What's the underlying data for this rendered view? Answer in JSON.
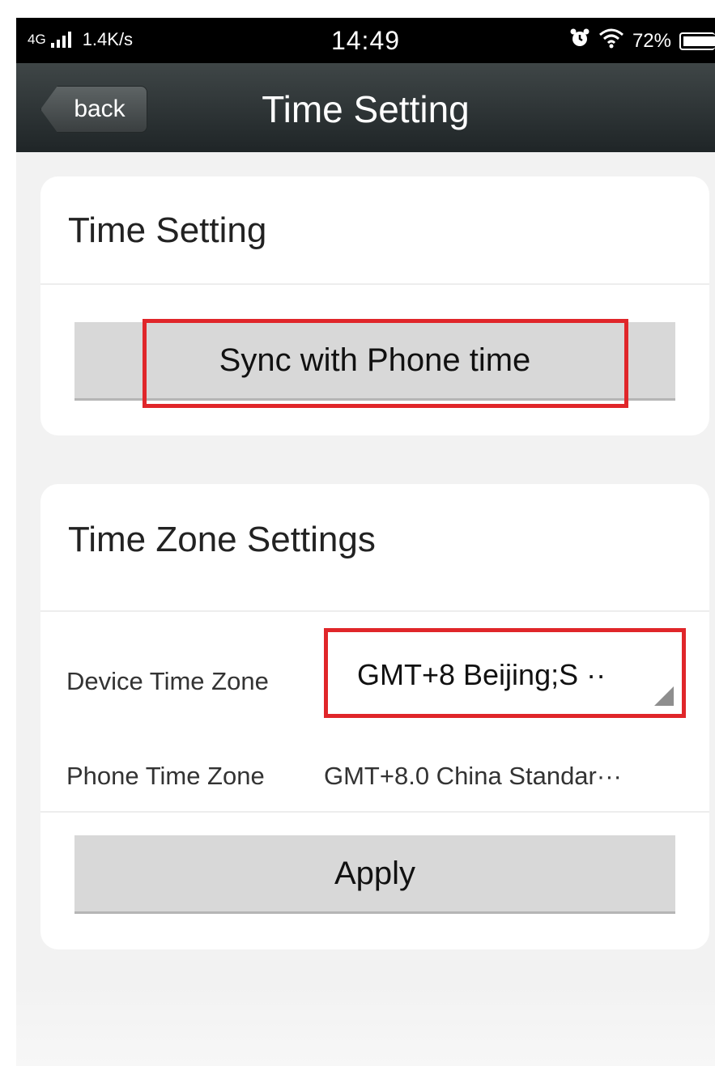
{
  "status_bar": {
    "network": "4G",
    "speed": "1.4K/s",
    "time": "14:49",
    "battery": "72%",
    "icons": [
      "signal-icon",
      "alarm-icon",
      "wifi-icon",
      "battery-icon"
    ]
  },
  "nav": {
    "back_label": "back",
    "title": "Time Setting"
  },
  "time_card": {
    "title": "Time Setting",
    "sync_label": "Sync with Phone time"
  },
  "zone_card": {
    "title": "Time Zone Settings",
    "device_label": "Device Time Zone",
    "device_value": "GMT+8 Beijing;S ··",
    "phone_label": "Phone Time Zone",
    "phone_value": "GMT+8.0  China Standar···",
    "apply_label": "Apply"
  },
  "colors": {
    "highlight": "#e0262a",
    "nav_bar": "#2c3334",
    "button": "#d8d8d8"
  }
}
